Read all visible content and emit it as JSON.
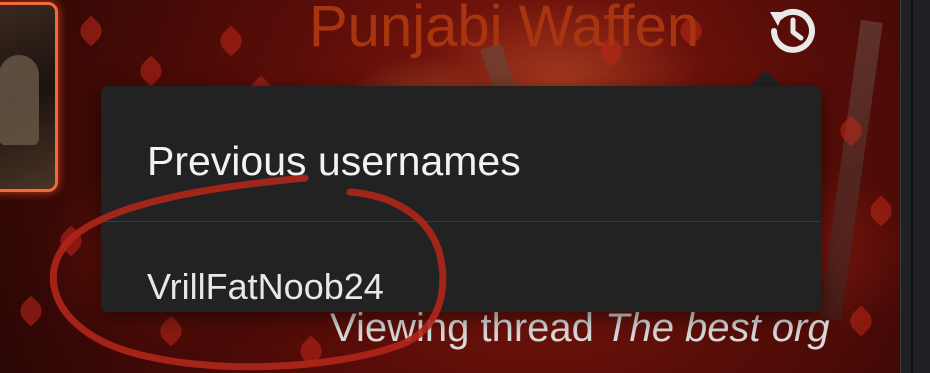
{
  "profile": {
    "username": "Punjabi Waffen",
    "username_color": "#a8350f"
  },
  "history_button": {
    "icon": "history-icon"
  },
  "previous_usernames": {
    "title": "Previous usernames",
    "items": [
      "VrillFatNoob24"
    ]
  },
  "activity": {
    "prefix": "Viewing thread",
    "thread_title": "The best org"
  },
  "annotation": {
    "color": "#b0261a"
  }
}
